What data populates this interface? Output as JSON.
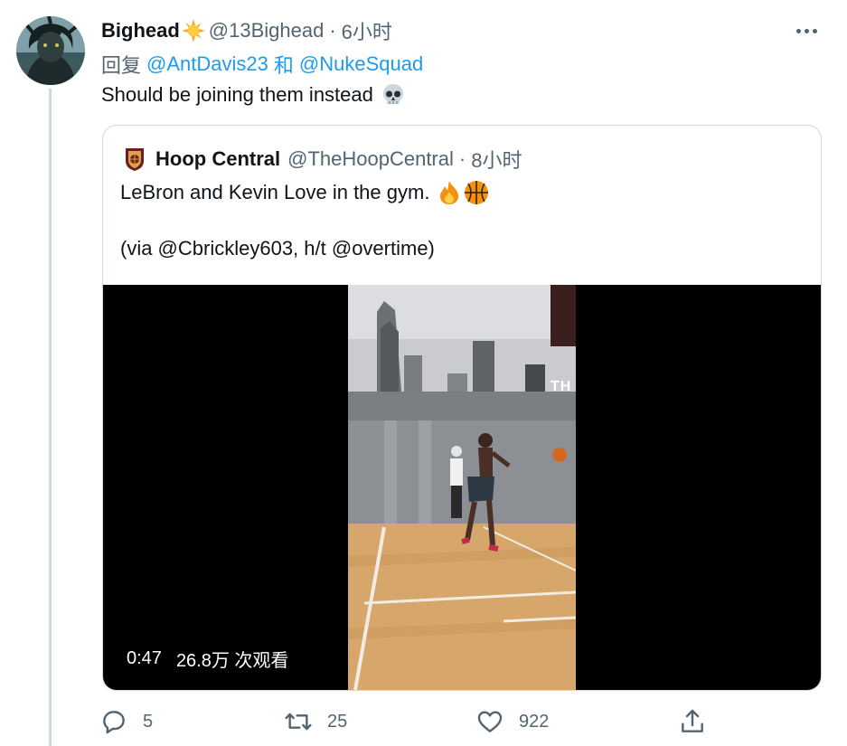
{
  "author": {
    "name": "Bighead",
    "badge_icon": "sun-emoji-icon",
    "handle": "@13Bighead",
    "time": "6小时"
  },
  "reply": {
    "prefix": "回复",
    "user1": "@AntDavis23",
    "joiner": "和",
    "user2": "@NukeSquad"
  },
  "tweet": {
    "text": "Should be joining them instead",
    "emoji_icon": "skull-emoji-icon"
  },
  "quote": {
    "name": "Hoop Central",
    "handle": "@TheHoopCentral",
    "time": "8小时",
    "line1": "LeBron and Kevin Love in the gym.",
    "line1_emoji": [
      "fire-emoji-icon",
      "basketball-emoji-icon"
    ],
    "line2": "(via @Cbrickley603, h/t @overtime)",
    "video": {
      "duration": "0:47",
      "views": "26.8万 次观看",
      "watermark": "TH"
    }
  },
  "actions": {
    "replies": "5",
    "retweets": "25",
    "likes": "922"
  },
  "colors": {
    "link": "#1d9bf0",
    "muted": "#536471",
    "border": "#cfd9de"
  }
}
